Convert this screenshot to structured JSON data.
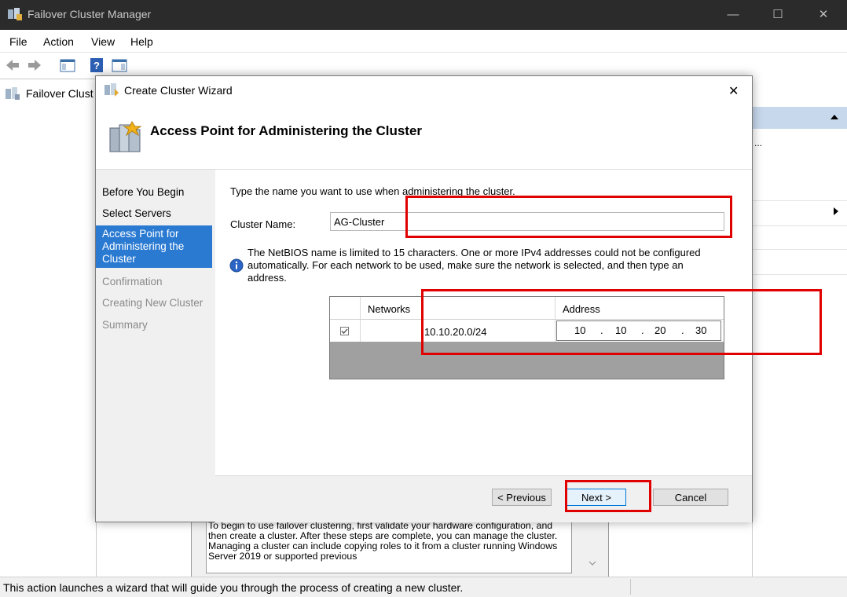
{
  "window": {
    "title": "Failover Cluster Manager",
    "controls": {
      "minimize": "—",
      "maximize": "☐",
      "close": "✕"
    }
  },
  "menu": [
    "File",
    "Action",
    "View",
    "Help"
  ],
  "tree": {
    "root_label": "Failover Clust"
  },
  "actions_pane": {
    "fragment": "..."
  },
  "background_text": "To begin to use failover clustering, first validate your hardware configuration, and then create a cluster.  After these steps are complete, you can manage the cluster. Managing a cluster can include copying roles to it from a cluster running Windows Server 2019 or supported previous",
  "status_text": "This action launches a wizard that will guide you through the process of creating a new cluster.",
  "dialog": {
    "title": "Create Cluster Wizard",
    "close_glyph": "✕",
    "header": "Access Point for Administering the Cluster",
    "steps": [
      {
        "label": "Before You Begin"
      },
      {
        "label": "Select Servers"
      },
      {
        "label": "Access Point for Administering the Cluster"
      },
      {
        "label": "Confirmation"
      },
      {
        "label": "Creating New Cluster"
      },
      {
        "label": "Summary"
      }
    ],
    "instruction": "Type the name you want to use when administering the cluster.",
    "cluster_name_label": "Cluster Name:",
    "cluster_name_value": "AG-Cluster",
    "info_text": "The NetBIOS name is limited to 15 characters.  One or more IPv4 addresses could not be configured automatically.  For each network to be used, make sure the network is selected, and then type an address.",
    "grid": {
      "headers": {
        "networks": "Networks",
        "address": "Address"
      },
      "row": {
        "checked": true,
        "network": "10.10.20.0/24",
        "octets": [
          "10",
          "10",
          "20",
          "30"
        ]
      }
    },
    "buttons": {
      "previous": "< Previous",
      "next": "Next >",
      "cancel": "Cancel"
    }
  },
  "colors": {
    "highlight": "#e00000",
    "selected_step": "#2a7ad2",
    "titlebar": "#2b2b2b"
  }
}
